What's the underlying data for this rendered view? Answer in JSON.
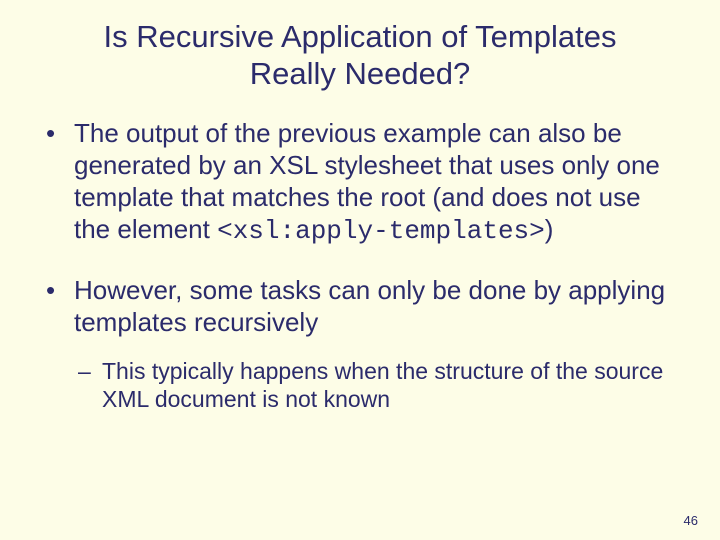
{
  "title": "Is Recursive Application of Templates Really Needed?",
  "bullet1_text": "The output of the previous example can also be generated by an XSL stylesheet that uses only one template that matches the root (and does not use the element ",
  "bullet1_code": "<xsl:apply-templates>",
  "bullet1_tail": ")",
  "bullet2_text": "However, some tasks can only be done by applying templates recursively",
  "bullet2_sub": "This typically happens when the structure of the source XML document is not known",
  "page_number": "46"
}
